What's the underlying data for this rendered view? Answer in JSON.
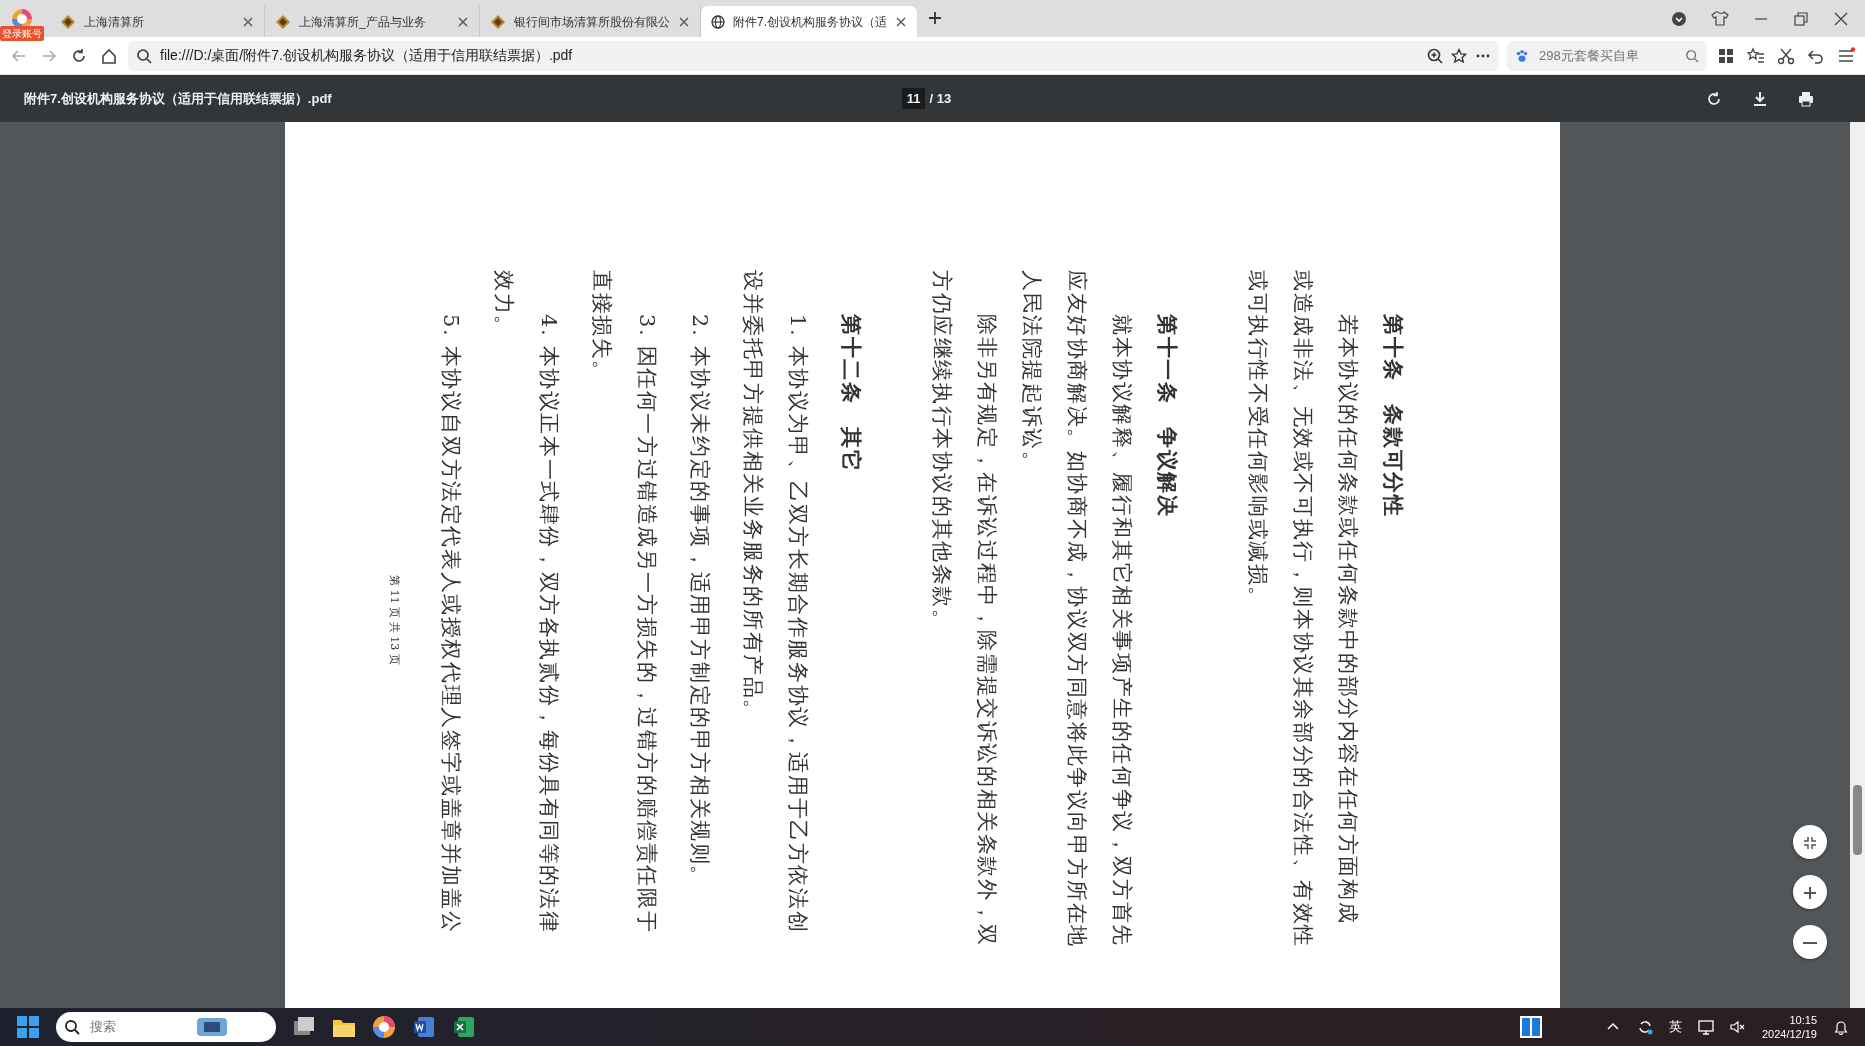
{
  "browser": {
    "account_badge": "登录账号",
    "tabs": [
      {
        "title": "上海清算所",
        "selected": false
      },
      {
        "title": "上海清算所_产品与业务",
        "selected": false
      },
      {
        "title": "银行间市场清算所股份有限公",
        "selected": false
      },
      {
        "title": "附件7.创设机构服务协议（适",
        "selected": true
      }
    ],
    "address": "file:///D:/桌面/附件7.创设机构服务协议（适用于信用联结票据）.pdf",
    "search": {
      "placeholder": "298元套餐买自卑"
    }
  },
  "pdf_viewer": {
    "title": "附件7.创设机构服务协议（适用于信用联结票据）.pdf",
    "page_current": "11",
    "page_total": "/ 13",
    "lines": [
      {
        "kind": "heading",
        "text": "第十条　条款可分性"
      },
      {
        "kind": "first",
        "text": "若本协议的任何条款或任何条款中的部分内容在任何方面构成"
      },
      {
        "kind": "body",
        "text": "或造成非法、无效或不可执行，则本协议其余部分的合法性、有效性"
      },
      {
        "kind": "body",
        "text": "或可执行性不受任何影响或减损。"
      },
      {
        "kind": "heading",
        "text": "第十一条　争议解决"
      },
      {
        "kind": "first",
        "text": "就本协议解释、履行和其它相关事项产生的任何争议，双方首先"
      },
      {
        "kind": "body",
        "text": "应友好协商解决。如协商不成，协议双方同意将此争议向甲方所在地"
      },
      {
        "kind": "body",
        "text": "人民法院提起诉讼。"
      },
      {
        "kind": "first",
        "text": "除非另有规定，在诉讼过程中，除需提交诉讼的相关条款外，双"
      },
      {
        "kind": "body",
        "text": "方仍应继续执行本协议的其他条款。"
      },
      {
        "kind": "heading",
        "text": "第十二条　其它"
      },
      {
        "kind": "item",
        "text": "1. 本协议为甲、乙双方长期合作服务协议，适用于乙方依法创"
      },
      {
        "kind": "body",
        "text": "设并委托甲方提供相关业务服务的所有产品。"
      },
      {
        "kind": "item",
        "text": "2. 本协议未约定的事项，适用甲方制定的甲方相关规则。"
      },
      {
        "kind": "item",
        "text": "3. 因任何一方过错造成另一方损失的，过错方的赔偿责任限于"
      },
      {
        "kind": "body",
        "text": "直接损失。"
      },
      {
        "kind": "item",
        "text": "4. 本协议正本一式肆份，双方各执贰份，每份具有同等的法律"
      },
      {
        "kind": "body",
        "text": "效力。"
      },
      {
        "kind": "item",
        "text": "5. 本协议自双方法定代表人或授权代理人签字或盖章并加盖公"
      }
    ],
    "footer": "第 11 页 共 13 页"
  },
  "taskbar": {
    "search_placeholder": "搜索",
    "ime": "英",
    "time": "10:15",
    "date": "2024/12/19"
  }
}
